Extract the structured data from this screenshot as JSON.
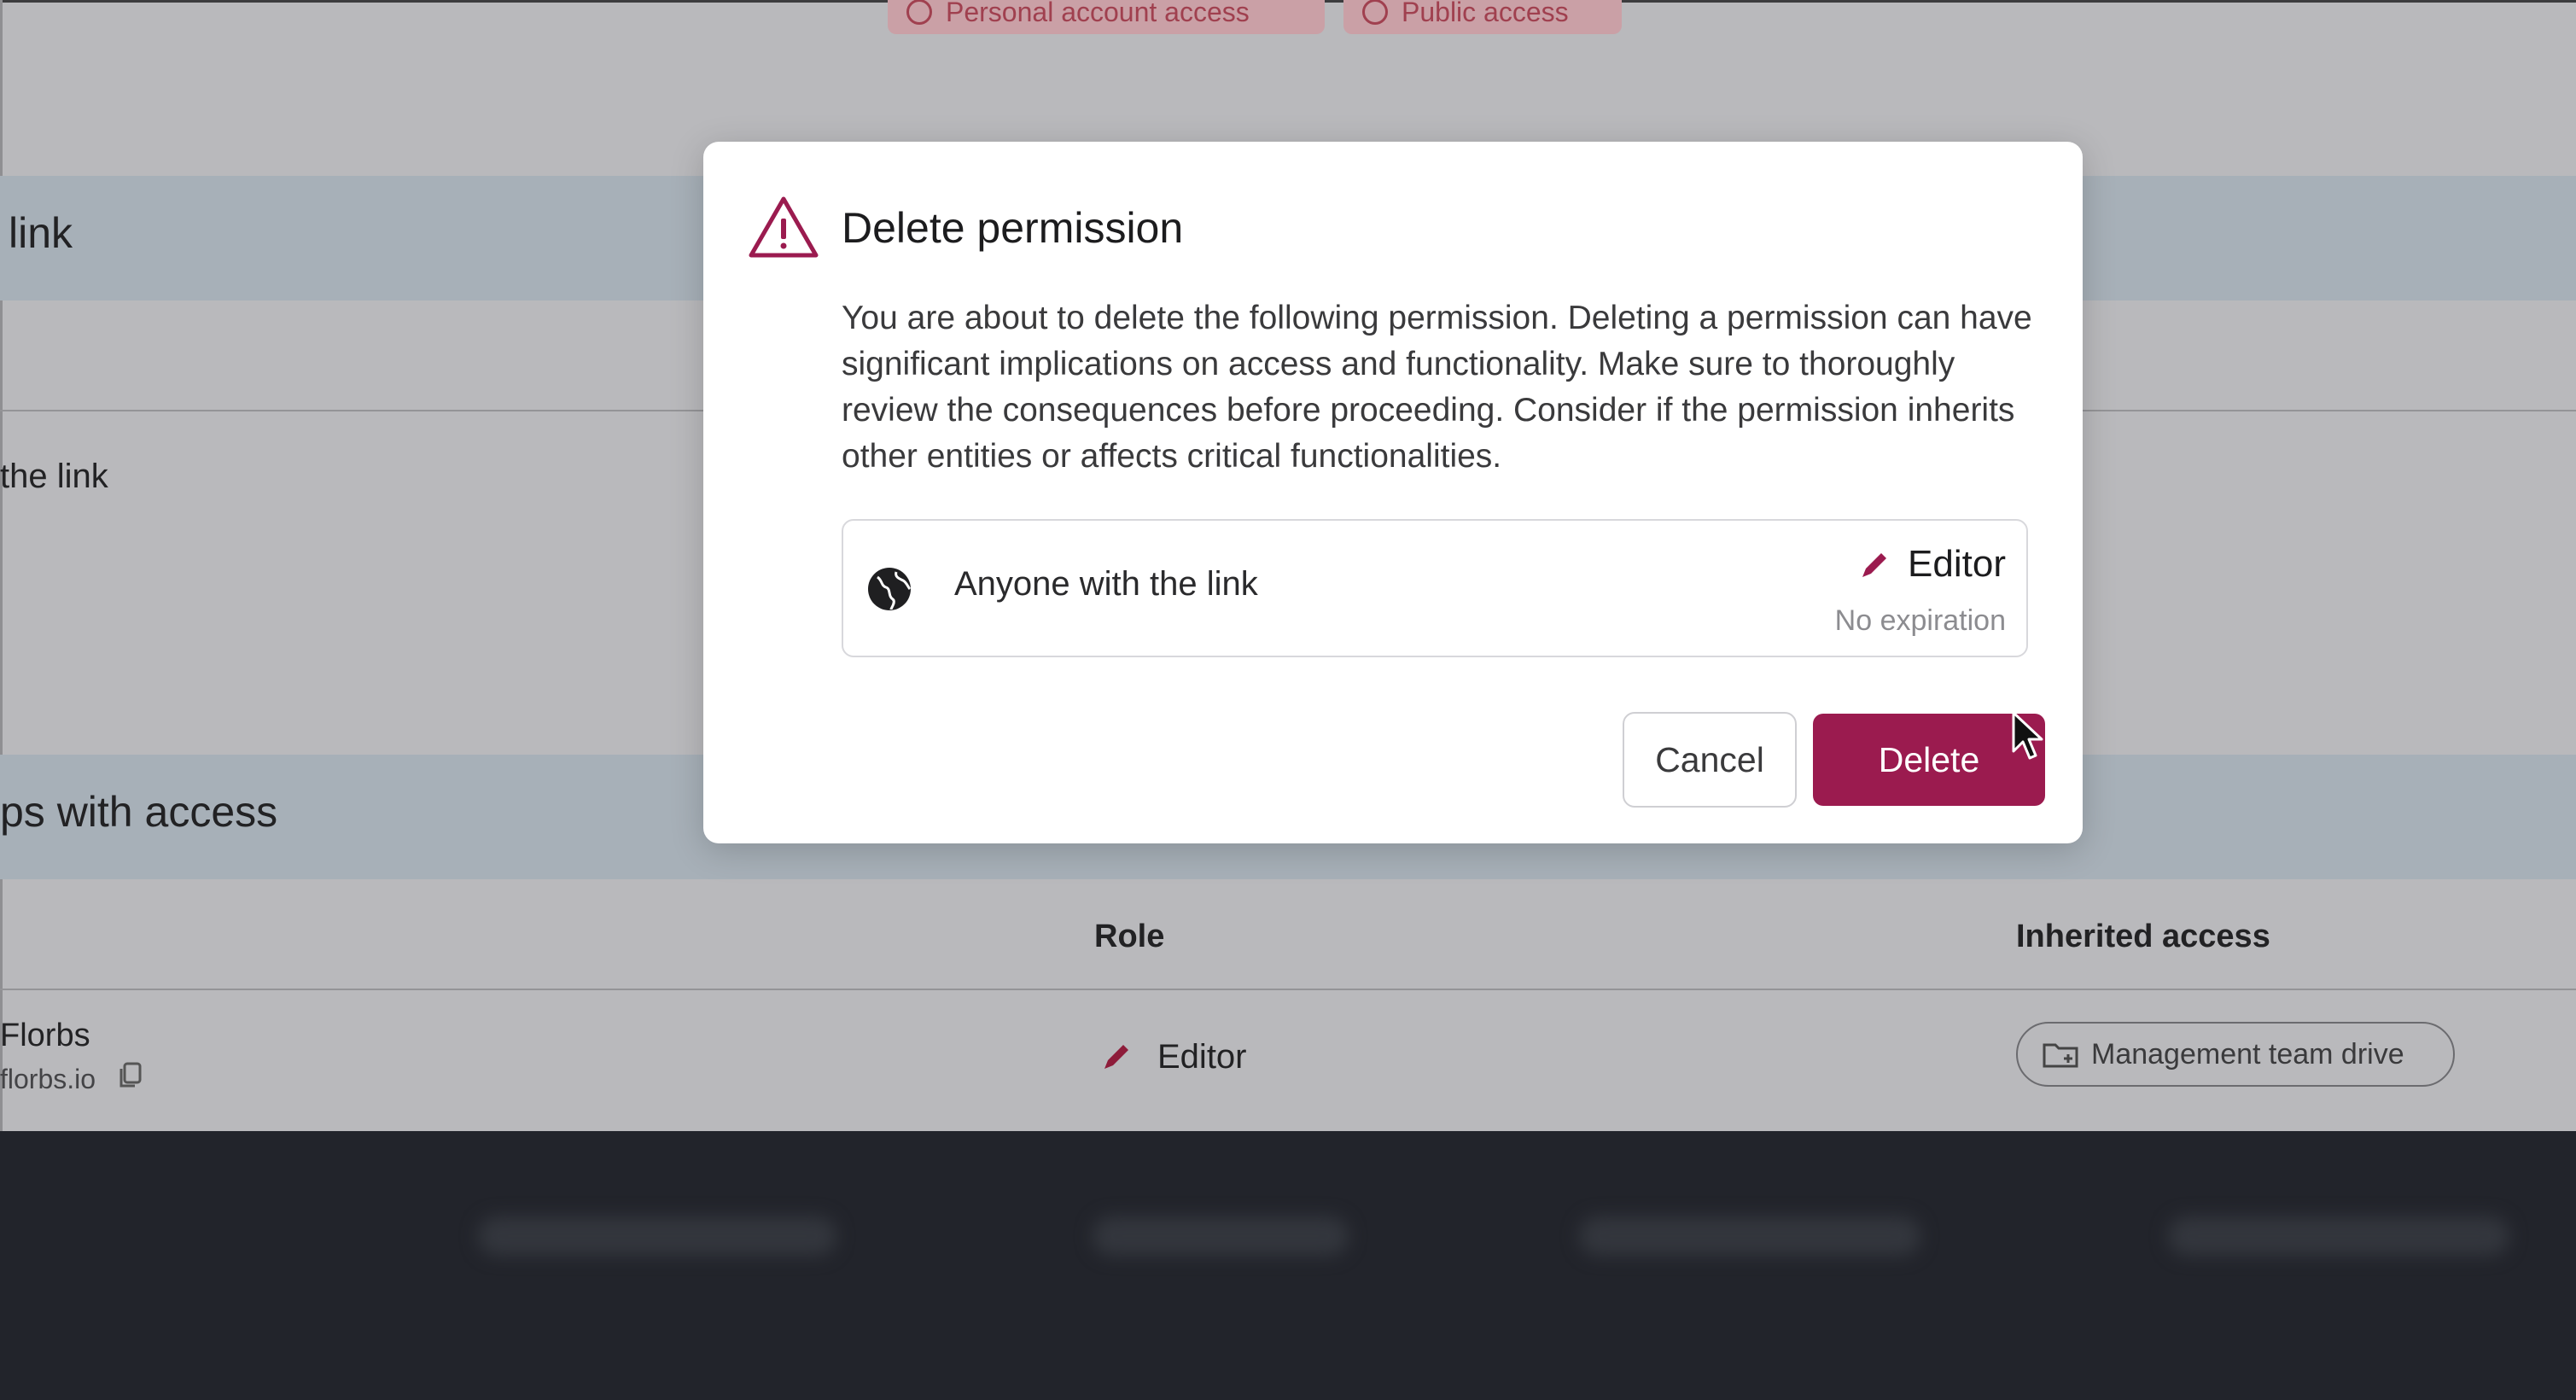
{
  "background": {
    "chips": [
      {
        "label": "Personal account access",
        "icon": "circle-user-icon"
      },
      {
        "label": "Public access",
        "icon": "circle-user-icon"
      }
    ],
    "section_link_title": "link",
    "row_label": "the link",
    "section_groups_title": "ps with access",
    "table": {
      "col_role": "Role",
      "col_inherited": "Inherited access",
      "row": {
        "name": "Florbs",
        "email": "florbs.io",
        "role": "Editor",
        "inherited": "Management team drive"
      }
    }
  },
  "dialog": {
    "title": "Delete permission",
    "body": "You are about to delete the following permission. Deleting a permission can have significant implications on access and functionality. Make sure to thoroughly review the consequences before proceeding. Consider if the permission inherits other entities or affects critical functionalities.",
    "permission": {
      "name": "Anyone with the link",
      "role": "Editor",
      "expiration": "No expiration",
      "icon": "globe-icon"
    },
    "cancel_label": "Cancel",
    "delete_label": "Delete"
  },
  "colors": {
    "accent": "#9b1b4f",
    "warning": "#9b1b4f",
    "overlay": "#b9b9bc",
    "footer": "#22242b"
  }
}
